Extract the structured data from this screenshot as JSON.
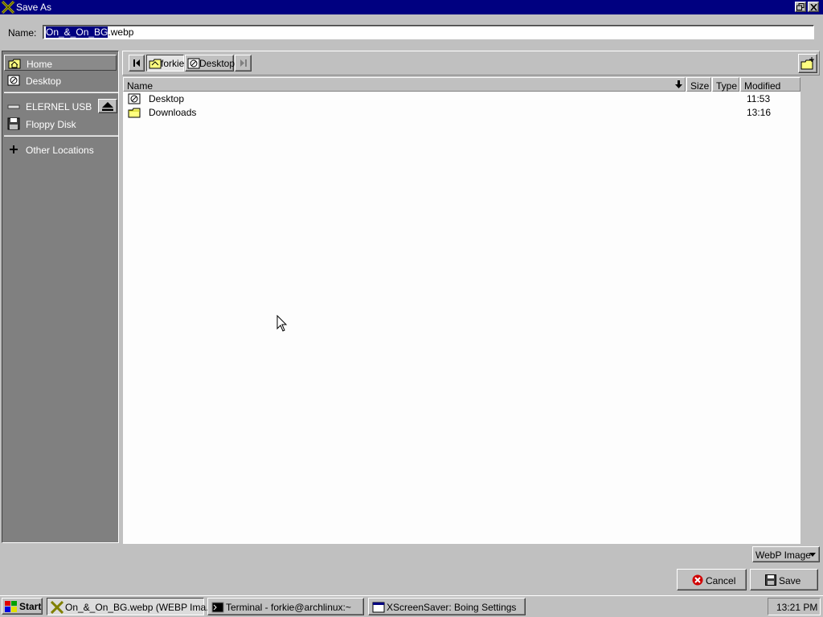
{
  "window": {
    "title": "Save As",
    "icon": "xorg-icon",
    "controls": [
      "restore-icon",
      "close-icon"
    ]
  },
  "name_field": {
    "label": "Name:",
    "selected_text": "On_&_On_BG",
    "suffix_text": ".webp"
  },
  "sidebar": {
    "items": [
      {
        "label": "Home",
        "icon": "home-folder-icon"
      },
      {
        "label": "Desktop",
        "icon": "desktop-icon"
      },
      {
        "label": "ELERNEL USB",
        "icon": "drive-icon"
      },
      {
        "label": "Floppy Disk",
        "icon": "floppy-icon"
      },
      {
        "label": "Other Locations",
        "icon": "plus-icon"
      }
    ]
  },
  "pathbar": {
    "crumbs": [
      {
        "label": "forkie",
        "icon": "home-folder-icon"
      },
      {
        "label": "Desktop",
        "icon": "desktop-icon"
      }
    ]
  },
  "file_list": {
    "columns": [
      "Name",
      "Size",
      "Type",
      "Modified"
    ],
    "rows": [
      {
        "name": "Desktop",
        "size": "",
        "type": "",
        "modified": "11:53",
        "icon": "desktop-icon"
      },
      {
        "name": "Downloads",
        "size": "",
        "type": "",
        "modified": "13:16",
        "icon": "folder-icon"
      }
    ]
  },
  "filter": {
    "selected": "WebP Image"
  },
  "buttons": {
    "cancel": "Cancel",
    "save": "Save"
  },
  "taskbar": {
    "start_label": "Start",
    "tasks": [
      {
        "label": "On_&_On_BG.webp (WEBP Ima...",
        "icon": "xorg-icon",
        "active": true
      },
      {
        "label": "Terminal - forkie@archlinux:~",
        "icon": "terminal-icon",
        "active": false
      },
      {
        "label": "XScreenSaver: Boing Settings",
        "icon": "window-icon",
        "active": false
      }
    ],
    "clock": "13:21 PM"
  },
  "colors": {
    "title_bar": "#000080",
    "face": "#c0c0c0",
    "sidebar": "#808080",
    "list_bg": "#fdfdfd",
    "selection": "#000080"
  }
}
